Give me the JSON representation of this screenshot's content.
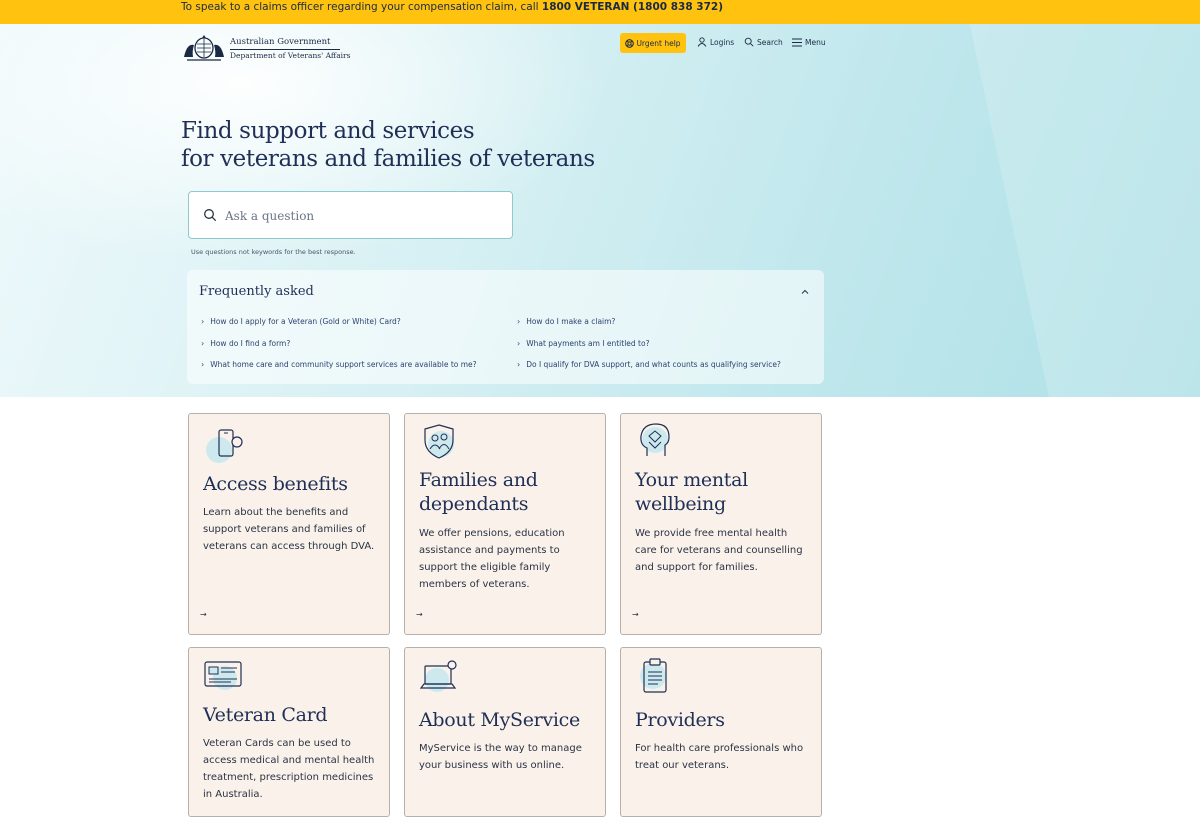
{
  "top_banner": {
    "text": "To speak to a claims officer regarding your compensation claim, call",
    "phone": "1800 VETERAN (1800 838 372)"
  },
  "header": {
    "logo_line1": "Australian Government",
    "logo_line2": "Department of Veterans' Affairs",
    "urgent_help": "Urgent help",
    "logins": "Logins",
    "search": "Search",
    "menu": "Menu"
  },
  "hero": {
    "title_line1": "Find support and services",
    "title_line2": "for veterans and families of veterans"
  },
  "search": {
    "placeholder": "Ask a question",
    "hint": "Use questions not keywords for the best response."
  },
  "faq": {
    "title": "Frequently asked",
    "items": [
      "How do I apply for a Veteran (Gold or White) Card?",
      "How do I make a claim?",
      "How do I find a form?",
      "What payments am I entitled to?",
      "What home care and community support services are available to me?",
      "Do I qualify for DVA support, and what counts as qualifying service?"
    ]
  },
  "cards": [
    {
      "title": "Access benefits",
      "description": "Learn about the benefits and support veterans and families of veterans can access through DVA.",
      "icon": "phone-icon"
    },
    {
      "title": "Families and dependants",
      "description": "We offer pensions, education assistance and payments to support the eligible family members of veterans.",
      "icon": "family-shield-icon"
    },
    {
      "title": "Your mental wellbeing",
      "description": "We provide free mental health care for veterans and counselling and support for families.",
      "icon": "head-heart-icon"
    },
    {
      "title": "Veteran Card",
      "description": "Veteran Cards can be used to access medical and mental health treatment, prescription medicines in Australia.",
      "icon": "id-card-icon"
    },
    {
      "title": "About MyService",
      "description": "MyService is the way to manage your business with us online.",
      "icon": "laptop-icon"
    },
    {
      "title": "Providers",
      "description": "For health care professionals who treat our veterans.",
      "icon": "clipboard-icon"
    }
  ],
  "colors": {
    "banner": "#ffc20e",
    "card_background": "#faf2ea",
    "heading": "#1f2f55",
    "hero_teal": "#bfe7ec"
  }
}
